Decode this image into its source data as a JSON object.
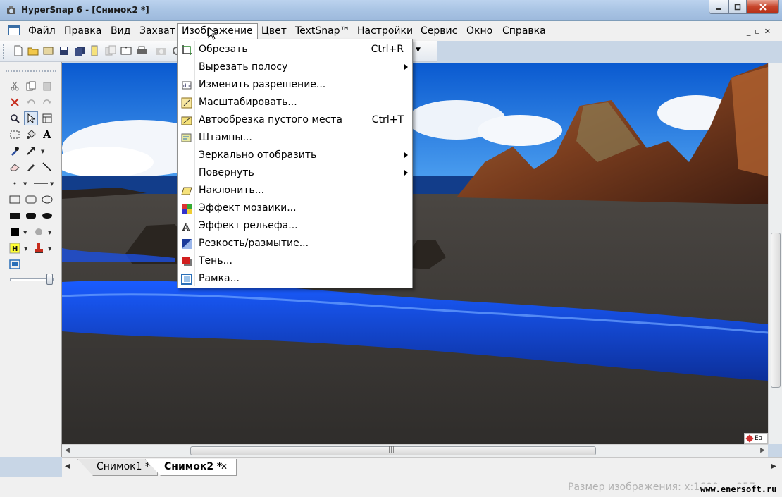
{
  "window": {
    "title": "HyperSnap 6 - [Снимок2 *]",
    "accent_color": "#1f4b95"
  },
  "menubar": {
    "items": [
      "Файл",
      "Правка",
      "Вид",
      "Захват",
      "Изображение",
      "Цвет",
      "TextSnap™",
      "Настройки",
      "Сервис",
      "Окно",
      "Справка"
    ],
    "open_item": "Изображение"
  },
  "image_menu": {
    "items": [
      {
        "label": "Обрезать",
        "shortcut": "Ctrl+R",
        "icon": "crop-icon"
      },
      {
        "label": "Вырезать полосу",
        "submenu": true
      },
      {
        "label": "Изменить разрешение...",
        "icon": "resolution-icon"
      },
      {
        "label": "Масштабировать...",
        "icon": "scale-icon"
      },
      {
        "label": "Автообрезка пустого места",
        "shortcut": "Ctrl+T",
        "icon": "autocrop-icon"
      },
      {
        "label": "Штампы...",
        "icon": "stamps-icon"
      },
      {
        "label": "Зеркально отобразить",
        "submenu": true
      },
      {
        "label": "Повернуть",
        "submenu": true
      },
      {
        "label": "Наклонить...",
        "icon": "skew-icon"
      },
      {
        "label": "Эффект мозаики...",
        "icon": "mosaic-icon"
      },
      {
        "label": "Эффект рельефа...",
        "icon": "emboss-icon"
      },
      {
        "label": "Резкость/размытие...",
        "icon": "sharpen-icon"
      },
      {
        "label": "Тень...",
        "icon": "shadow-icon"
      },
      {
        "label": "Рамка...",
        "icon": "frame-icon"
      }
    ]
  },
  "tabs": [
    {
      "label": "Снимок1 *",
      "active": false
    },
    {
      "label": "Снимок2 *",
      "active": true
    }
  ],
  "tab_close": "✕",
  "statusbar": {
    "text": "Размер изображения: x:1600 , y:957",
    "watermark": "www.enersoft.ru"
  },
  "corner_tag": "Ea"
}
